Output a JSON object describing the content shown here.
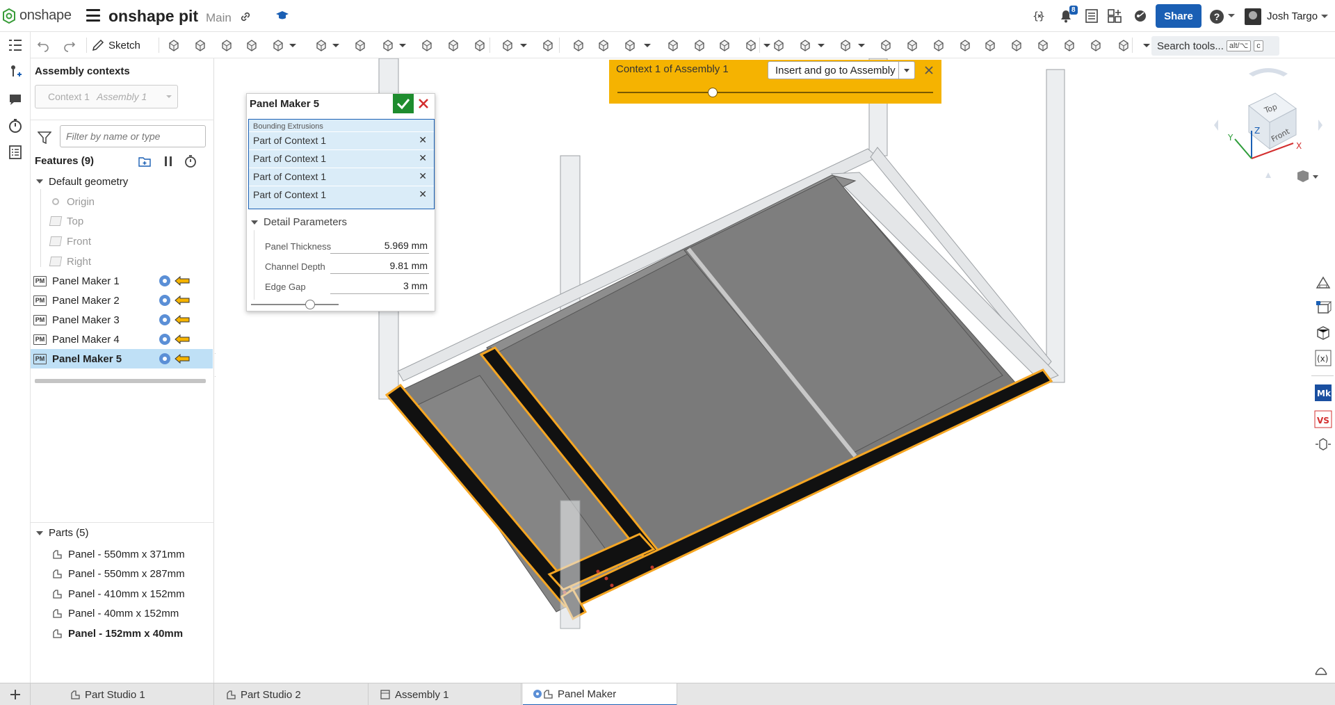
{
  "app": {
    "brand": "onshape",
    "document_title": "onshape pit",
    "branch": "Main",
    "notification_count": "8",
    "share_label": "Share",
    "user_name": "Josh Targo"
  },
  "toolbar": {
    "sketch_label": "Sketch",
    "search_label": "Search tools...",
    "search_shortcut_a": "alt/⌥",
    "search_shortcut_b": "c"
  },
  "feature_panel": {
    "assembly_contexts_title": "Assembly contexts",
    "context_select_label": "Context 1",
    "context_select_value": "Assembly 1",
    "filter_placeholder": "Filter by name or type",
    "features_header": "Features (9)",
    "default_geometry": "Default geometry",
    "default_items": [
      "Origin",
      "Top",
      "Front",
      "Right"
    ],
    "features": [
      {
        "badge": "PM",
        "label": "Panel Maker 1"
      },
      {
        "badge": "PM",
        "label": "Panel Maker 2"
      },
      {
        "badge": "PM",
        "label": "Panel Maker 3"
      },
      {
        "badge": "PM",
        "label": "Panel Maker 4"
      },
      {
        "badge": "PM",
        "label": "Panel Maker 5"
      }
    ],
    "parts_header": "Parts (5)",
    "parts": [
      "Panel - 550mm x 371mm",
      "Panel - 550mm x 287mm",
      "Panel - 410mm x 152mm",
      "Panel - 40mm x 152mm",
      "Panel - 152mm x 40mm"
    ]
  },
  "dialog": {
    "title": "Panel Maker 5",
    "selection_title": "Bounding Extrusions",
    "selections": [
      "Part of Context 1",
      "Part of Context 1",
      "Part of Context 1",
      "Part of Context 1"
    ],
    "detail_header": "Detail Parameters",
    "params": [
      {
        "label": "Panel Thickness",
        "value": "5.969 mm"
      },
      {
        "label": "Channel Depth",
        "value": "9.81 mm"
      },
      {
        "label": "Edge Gap",
        "value": "3 mm"
      }
    ]
  },
  "context_banner": {
    "text": "Context 1 of Assembly 1",
    "button_label": "Insert and go to Assembly"
  },
  "view_cube": {
    "top_label": "Top",
    "front_label": "Front",
    "x_label": "X",
    "y_label": "Y",
    "z_label": "Z"
  },
  "tabs": [
    "Part Studio 1",
    "Part Studio 2",
    "Assembly 1",
    "Panel Maker"
  ],
  "colors": {
    "accent_blue": "#1a5fb4",
    "banner_yellow": "#f5b301",
    "selection_bg": "#bfe0f6",
    "highlight_orange": "#f5a623",
    "confirm_green": "#1e8c2e",
    "cancel_red": "#d32f2f"
  }
}
